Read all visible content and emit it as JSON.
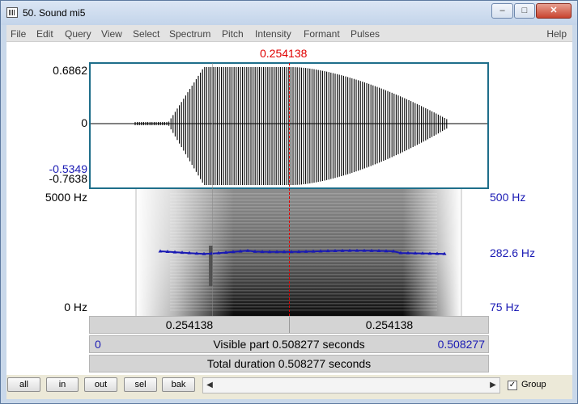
{
  "window": {
    "title": "50. Sound mi5"
  },
  "menu": {
    "items": [
      "File",
      "Edit",
      "Query",
      "View",
      "Select",
      "Spectrum",
      "Pitch",
      "Intensity",
      "Formant",
      "Pulses"
    ],
    "help": "Help"
  },
  "cursor": {
    "time": "0.254138"
  },
  "waveform": {
    "y_max": "0.6862",
    "y_zero": "0",
    "y_cursor": "-0.5349",
    "y_min": "-0.7638"
  },
  "spectrogram": {
    "freq_max": "5000 Hz",
    "freq_min": "0 Hz"
  },
  "pitch": {
    "max": "500 Hz",
    "cursor": "282.6 Hz",
    "min": "75 Hz"
  },
  "bars": {
    "left_time": "0.254138",
    "right_time": "0.254138",
    "visible_start": "0",
    "visible_text": "Visible part 0.508277 seconds",
    "visible_end": "0.508277",
    "total_text": "Total duration 0.508277 seconds"
  },
  "toolbar": {
    "all": "all",
    "in": "in",
    "out": "out",
    "sel": "sel",
    "bak": "bak",
    "group_label": "Group",
    "group_checked": true
  },
  "colors": {
    "cursor": "#e00000",
    "pitch_track": "#1a1ab4",
    "wave_border": "#1e6e8a"
  }
}
